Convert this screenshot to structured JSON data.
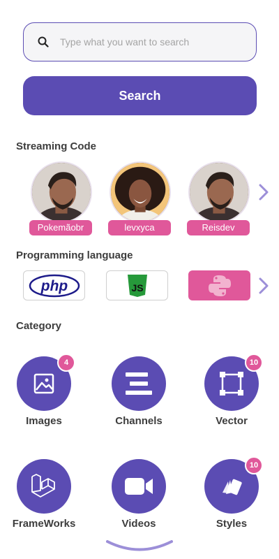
{
  "search": {
    "placeholder": "Type what you want to search",
    "button_label": "Search"
  },
  "streaming": {
    "title": "Streaming Code",
    "streamers": [
      {
        "name": "Pokemãobr"
      },
      {
        "name": "levxyca"
      },
      {
        "name": "Reisdev"
      }
    ]
  },
  "languages": {
    "title": "Programming language",
    "items": [
      {
        "name": "php",
        "icon": "php-logo-icon"
      },
      {
        "name": "JS",
        "icon": "javascript-logo-icon"
      },
      {
        "name": "python",
        "icon": "python-logo-icon"
      }
    ]
  },
  "category": {
    "title": "Category",
    "items": [
      {
        "label": "Images",
        "badge": "4",
        "icon": "image-icon"
      },
      {
        "label": "Channels",
        "badge": "",
        "icon": "channels-icon"
      },
      {
        "label": "Vector",
        "badge": "10",
        "icon": "vector-icon"
      },
      {
        "label": "FrameWorks",
        "badge": "",
        "icon": "laravel-icon"
      },
      {
        "label": "Videos",
        "badge": "",
        "icon": "video-camera-icon"
      },
      {
        "label": "Styles",
        "badge": "10",
        "icon": "cards-icon"
      }
    ]
  },
  "colors": {
    "primary": "#5b4cb3",
    "accent": "#e0589a",
    "chevron": "#9c8fd8"
  }
}
